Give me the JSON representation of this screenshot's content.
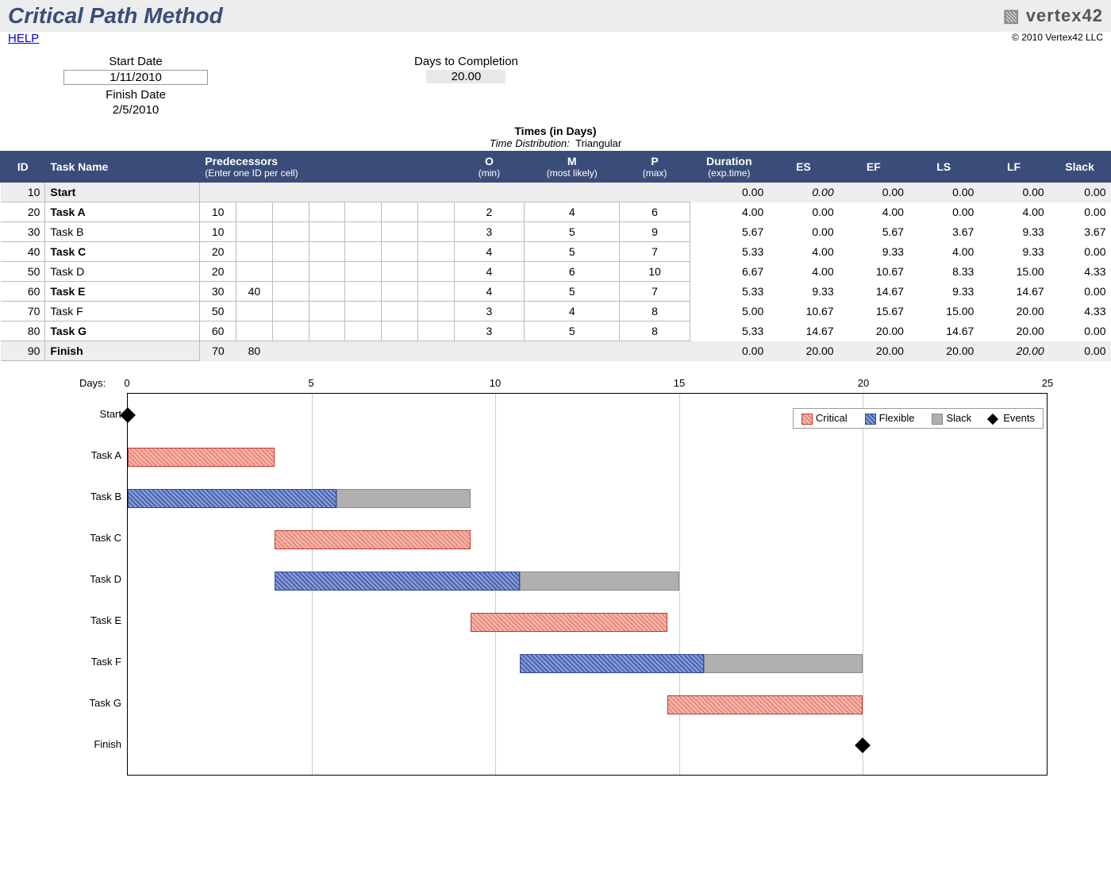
{
  "header": {
    "title": "Critical Path Method",
    "logo": "vertex42",
    "copyright": "© 2010 Vertex42 LLC",
    "help": "HELP"
  },
  "summary": {
    "start_date_label": "Start Date",
    "start_date": "1/11/2010",
    "finish_date_label": "Finish Date",
    "finish_date": "2/5/2010",
    "days_to_completion_label": "Days to Completion",
    "days_to_completion": "20.00"
  },
  "times": {
    "header": "Times (in Days)",
    "dist_label": "Time Distribution:",
    "dist_value": "Triangular"
  },
  "table": {
    "headers": {
      "id": "ID",
      "task": "Task Name",
      "pred": "Predecessors",
      "pred_sub": "(Enter one ID per cell)",
      "o": "O",
      "o_sub": "(min)",
      "m": "M",
      "m_sub": "(most likely)",
      "p": "P",
      "p_sub": "(max)",
      "dur": "Duration",
      "dur_sub": "(exp.time)",
      "es": "ES",
      "ef": "EF",
      "ls": "LS",
      "lf": "LF",
      "slack": "Slack"
    },
    "rows": [
      {
        "id": "10",
        "name": "Start",
        "bold": true,
        "shaded": true,
        "preds": [
          "",
          "",
          "",
          "",
          "",
          "",
          ""
        ],
        "o": "",
        "m": "",
        "p": "",
        "dur": "0.00",
        "es": "0.00",
        "es_it": true,
        "ef": "0.00",
        "ls": "0.00",
        "lf": "0.00",
        "slack": "0.00"
      },
      {
        "id": "20",
        "name": "Task A",
        "bold": true,
        "preds": [
          "10",
          "",
          "",
          "",
          "",
          "",
          ""
        ],
        "o": "2",
        "m": "4",
        "p": "6",
        "dur": "4.00",
        "es": "0.00",
        "ef": "4.00",
        "ls": "0.00",
        "lf": "4.00",
        "slack": "0.00"
      },
      {
        "id": "30",
        "name": "Task B",
        "preds": [
          "10",
          "",
          "",
          "",
          "",
          "",
          ""
        ],
        "o": "3",
        "m": "5",
        "p": "9",
        "dur": "5.67",
        "es": "0.00",
        "ef": "5.67",
        "ls": "3.67",
        "lf": "9.33",
        "slack": "3.67"
      },
      {
        "id": "40",
        "name": "Task C",
        "bold": true,
        "preds": [
          "20",
          "",
          "",
          "",
          "",
          "",
          ""
        ],
        "o": "4",
        "m": "5",
        "p": "7",
        "dur": "5.33",
        "es": "4.00",
        "ef": "9.33",
        "ls": "4.00",
        "lf": "9.33",
        "slack": "0.00"
      },
      {
        "id": "50",
        "name": "Task D",
        "preds": [
          "20",
          "",
          "",
          "",
          "",
          "",
          ""
        ],
        "o": "4",
        "m": "6",
        "p": "10",
        "dur": "6.67",
        "es": "4.00",
        "ef": "10.67",
        "ls": "8.33",
        "lf": "15.00",
        "slack": "4.33"
      },
      {
        "id": "60",
        "name": "Task E",
        "bold": true,
        "preds": [
          "30",
          "40",
          "",
          "",
          "",
          "",
          ""
        ],
        "o": "4",
        "m": "5",
        "p": "7",
        "dur": "5.33",
        "es": "9.33",
        "ef": "14.67",
        "ls": "9.33",
        "lf": "14.67",
        "slack": "0.00"
      },
      {
        "id": "70",
        "name": "Task F",
        "preds": [
          "50",
          "",
          "",
          "",
          "",
          "",
          ""
        ],
        "o": "3",
        "m": "4",
        "p": "8",
        "dur": "5.00",
        "es": "10.67",
        "ef": "15.67",
        "ls": "15.00",
        "lf": "20.00",
        "slack": "4.33"
      },
      {
        "id": "80",
        "name": "Task G",
        "bold": true,
        "preds": [
          "60",
          "",
          "",
          "",
          "",
          "",
          ""
        ],
        "o": "3",
        "m": "5",
        "p": "8",
        "dur": "5.33",
        "es": "14.67",
        "ef": "20.00",
        "ls": "14.67",
        "lf": "20.00",
        "slack": "0.00"
      },
      {
        "id": "90",
        "name": "Finish",
        "bold": true,
        "shaded": true,
        "preds": [
          "70",
          "80",
          "",
          "",
          "",
          "",
          ""
        ],
        "o": "",
        "m": "",
        "p": "",
        "dur": "0.00",
        "es": "20.00",
        "ef": "20.00",
        "ls": "20.00",
        "lf": "20.00",
        "lf_it": true,
        "slack": "0.00"
      }
    ]
  },
  "chart_data": {
    "type": "gantt",
    "xlabel": "Days:",
    "xticks": [
      0,
      5,
      10,
      15,
      20,
      25
    ],
    "xlim": [
      0,
      25
    ],
    "legend": [
      "Critical",
      "Flexible",
      "Slack",
      "Events"
    ],
    "rows": [
      {
        "label": "Start",
        "event_at": 0
      },
      {
        "label": "Task A",
        "bars": [
          {
            "kind": "critical",
            "from": 0,
            "to": 4
          }
        ]
      },
      {
        "label": "Task B",
        "bars": [
          {
            "kind": "flexible",
            "from": 0,
            "to": 5.67
          },
          {
            "kind": "slack",
            "from": 5.67,
            "to": 9.33
          }
        ]
      },
      {
        "label": "Task C",
        "bars": [
          {
            "kind": "critical",
            "from": 4,
            "to": 9.33
          }
        ]
      },
      {
        "label": "Task D",
        "bars": [
          {
            "kind": "flexible",
            "from": 4,
            "to": 10.67
          },
          {
            "kind": "slack",
            "from": 10.67,
            "to": 15
          }
        ]
      },
      {
        "label": "Task E",
        "bars": [
          {
            "kind": "critical",
            "from": 9.33,
            "to": 14.67
          }
        ]
      },
      {
        "label": "Task F",
        "bars": [
          {
            "kind": "flexible",
            "from": 10.67,
            "to": 15.67
          },
          {
            "kind": "slack",
            "from": 15.67,
            "to": 20
          }
        ]
      },
      {
        "label": "Task G",
        "bars": [
          {
            "kind": "critical",
            "from": 14.67,
            "to": 20
          }
        ]
      },
      {
        "label": "Finish",
        "event_at": 20
      }
    ]
  }
}
